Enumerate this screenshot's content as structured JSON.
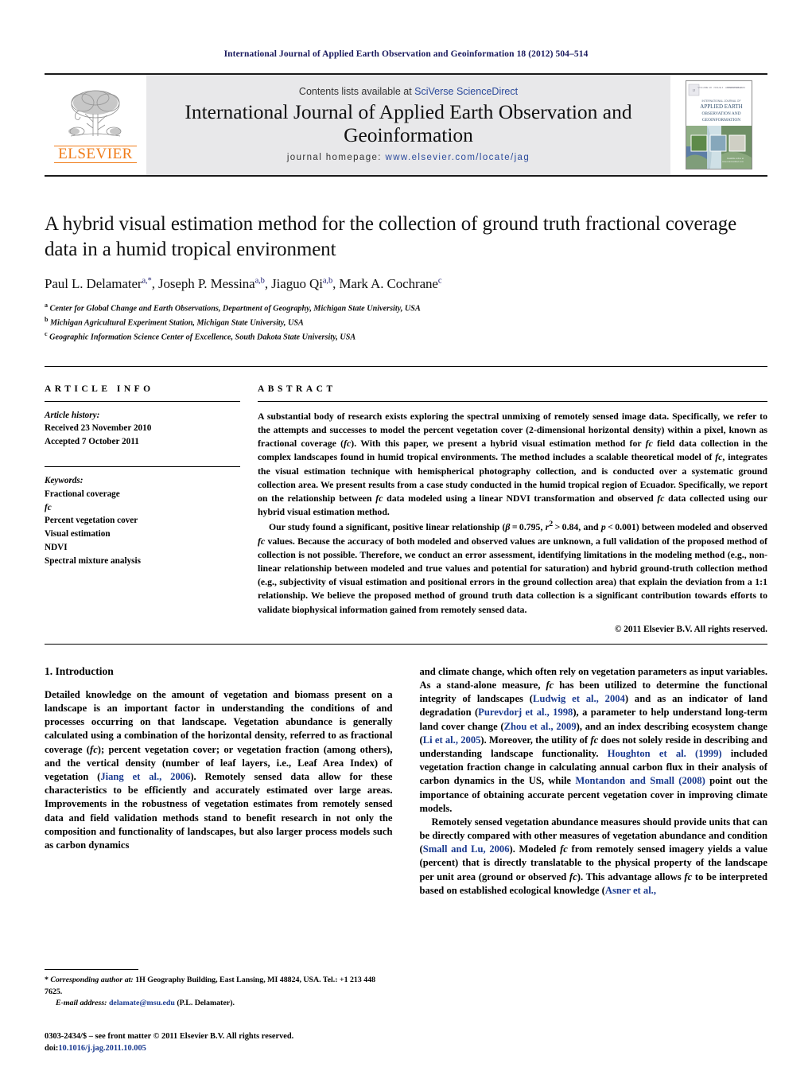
{
  "running_head": "International Journal of Applied Earth Observation and Geoinformation 18 (2012) 504–514",
  "masthead": {
    "contents_prefix": "Contents lists available at ",
    "contents_link": "SciVerse ScienceDirect",
    "journal_title": "International Journal of Applied Earth Observation and Geoinformation",
    "homepage_prefix": "journal homepage: ",
    "homepage_url": "www.elsevier.com/locate/jag",
    "publisher_logo_text": "ELSEVIER",
    "cover_title_line1": "APPLIED EARTH",
    "cover_title_line2": "OBSERVATION AND",
    "cover_title_line3": "GEOINFORMATION",
    "colors": {
      "elsevier_orange": "#f07c18",
      "link_blue": "#2b4a9b",
      "runhead_navy": "#1a1a5e",
      "masthead_grey": "#e8e8ea"
    }
  },
  "article": {
    "title": "A hybrid visual estimation method for the collection of ground truth fractional coverage data in a humid tropical environment",
    "authors_html": "Paul L. Delamater<sup>a,*</sup>, Joseph P. Messina<sup>a,b</sup>, Jiaguo Qi<sup>a,b</sup>, Mark A. Cochrane<sup>c</sup>",
    "affiliations": [
      {
        "marker": "a",
        "text": "Center for Global Change and Earth Observations, Department of Geography, Michigan State University, USA"
      },
      {
        "marker": "b",
        "text": "Michigan Agricultural Experiment Station, Michigan State University, USA"
      },
      {
        "marker": "c",
        "text": "Geographic Information Science Center of Excellence, South Dakota State University, USA"
      }
    ]
  },
  "article_info": {
    "heading": "ARTICLE INFO",
    "history_label": "Article history:",
    "history": [
      "Received 23 November 2010",
      "Accepted 7 October 2011"
    ],
    "keywords_label": "Keywords:",
    "keywords": [
      "Fractional coverage",
      "fc",
      "Percent vegetation cover",
      "Visual estimation",
      "NDVI",
      "Spectral mixture analysis"
    ]
  },
  "abstract": {
    "heading": "ABSTRACT",
    "paragraph1_html": "A substantial body of research exists exploring the spectral unmixing of remotely sensed image data. Specifically, we refer to the attempts and successes to model the percent vegetation cover (2-dimensional horizontal density) within a pixel, known as fractional coverage (<i>fc</i>). With this paper, we present a hybrid visual estimation method for <i>fc</i> field data collection in the complex landscapes found in humid tropical environments. The method includes a scalable theoretical model of <i>fc</i>, integrates the visual estimation technique with hemispherical photography collection, and is conducted over a systematic ground collection area. We present results from a case study conducted in the humid tropical region of Ecuador. Specifically, we report on the relationship between <i>fc</i> data modeled using a linear NDVI transformation and observed <i>fc</i> data collected using our hybrid visual estimation method.",
    "paragraph2_html": "Our study found a significant, positive linear relationship (<i>&beta;</i>&#8201;=&#8201;0.795, <i>r</i><sup>2</sup>&#8201;&gt;&#8201;0.84, and <i>p</i>&#8201;&lt;&#8201;0.001) between modeled and observed <i>fc</i> values. Because the accuracy of both modeled and observed values are unknown, a full validation of the proposed method of collection is not possible. Therefore, we conduct an error assessment, identifying limitations in the modeling method (e.g., non-linear relationship between modeled and true values and potential for saturation) and hybrid ground-truth collection method (e.g., subjectivity of visual estimation and positional errors in the ground collection area) that explain the deviation from a 1:1 relationship. We believe the proposed method of ground truth data collection is a significant contribution towards efforts to validate biophysical information gained from remotely sensed data.",
    "copyright": "© 2011 Elsevier B.V. All rights reserved."
  },
  "body": {
    "section_number_title": "1.  Introduction",
    "left_column_html": "Detailed knowledge on the amount of vegetation and biomass present on a landscape is an important factor in understanding the conditions of and processes occurring on that landscape. Vegetation abundance is generally calculated using a combination of the horizontal density, referred to as fractional coverage (<i>fc</i>); percent vegetation cover; or vegetation fraction (among others), and the vertical density (number of leaf layers, i.e., Leaf Area Index) of vegetation (<span class=\"cite\">Jiang et al., 2006</span>). Remotely sensed data allow for these characteristics to be efficiently and accurately estimated over large areas. Improvements in the robustness of vegetation estimates from remotely sensed data and field validation methods stand to benefit research in not only the composition and functionality of landscapes, but also larger process models such as carbon dynamics",
    "right_column_p1_html": "and climate change, which often rely on vegetation parameters as input variables. As a stand-alone measure, <i>fc</i> has been utilized to determine the functional integrity of landscapes (<span class=\"cite\">Ludwig et al., 2004</span>) and as an indicator of land degradation (<span class=\"cite\">Purevdorj et al., 1998</span>), a parameter to help understand long-term land cover change (<span class=\"cite\">Zhou et al., 2009</span>), and an index describing ecosystem change (<span class=\"cite\">Li et al., 2005</span>). Moreover, the utility of <i>fc</i> does not solely reside in describing and understanding landscape functionality. <span class=\"cite\">Houghton et al. (1999)</span> included vegetation fraction change in calculating annual carbon flux in their analysis of carbon dynamics in the US, while <span class=\"cite\">Montandon and Small (2008)</span> point out the importance of obtaining accurate percent vegetation cover in improving climate models.",
    "right_column_p2_html": "Remotely sensed vegetation abundance measures should provide units that can be directly compared with other measures of vegetation abundance and condition (<span class=\"cite\">Small and Lu, 2006</span>). Modeled <i>fc</i> from remotely sensed imagery yields a value (percent) that is directly translatable to the physical property of the landscape per unit area (ground or observed <i>fc</i>). This advantage allows <i>fc</i> to be interpreted based on established ecological knowledge (<span class=\"cite\">Asner et al.,</span>"
  },
  "footnotes": {
    "corresponding_html": "* <span class=\"ital\">Corresponding author at:</span> 1H Geography Building, East Lansing, MI 48824, USA. Tel.: +1 213 448 7625.",
    "email_html": "<span class=\"ital\">E-mail address:</span> <span class=\"link\">delamate@msu.edu</span> (P.L. Delamater)."
  },
  "imprint": {
    "line1": "0303-2434/$ – see front matter © 2011 Elsevier B.V. All rights reserved.",
    "doi_label": "doi:",
    "doi_value": "10.1016/j.jag.2011.10.005"
  }
}
